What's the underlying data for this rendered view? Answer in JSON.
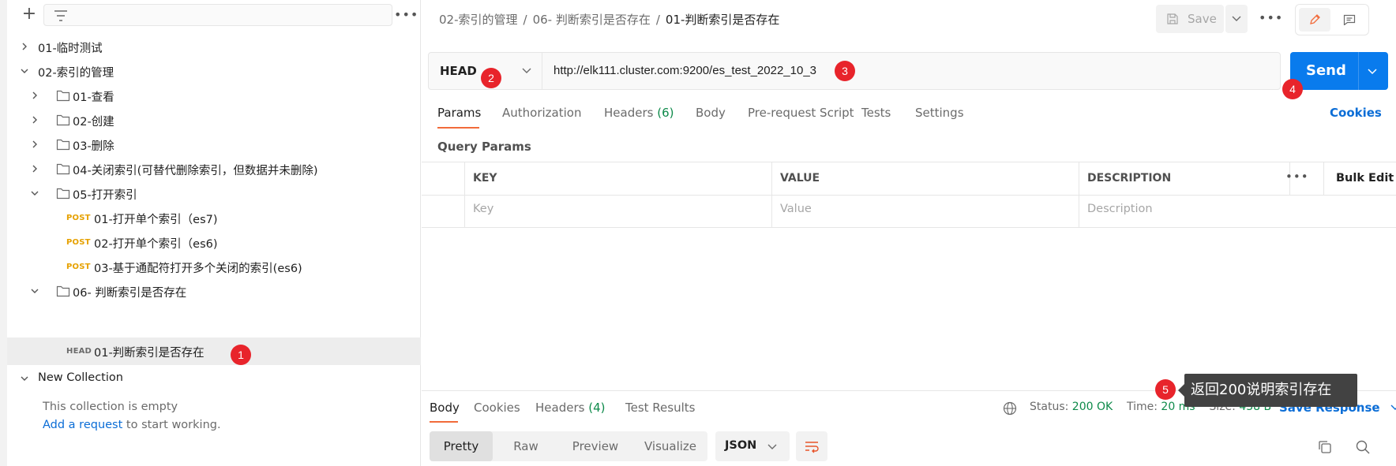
{
  "sidebar": {
    "collections": [
      {
        "label": "01-临时测试"
      },
      {
        "label": "02-索引的管理"
      },
      {
        "label": "01-查看"
      },
      {
        "label": "02-创建"
      },
      {
        "label": "03-删除"
      },
      {
        "label": "04-关闭索引(可替代删除索引，但数据并未删除)"
      },
      {
        "label": "05-打开索引"
      },
      {
        "method": "POST",
        "label": "01-打开单个索引（es7)"
      },
      {
        "method": "POST",
        "label": "02-打开单个索引（es6)"
      },
      {
        "method": "POST",
        "label": "03-基于通配符打开多个关闭的索引(es6)"
      },
      {
        "label": "06- 判断索引是否存在"
      },
      {
        "method": "HEAD",
        "label": "01-判断索引是否存在"
      },
      {
        "label": "New Collection"
      }
    ],
    "empty_text": "This collection is empty",
    "add_request_link": "Add a request",
    "add_request_suffix": " to start working."
  },
  "breadcrumb": {
    "parts": [
      "02-索引的管理",
      "06- 判断索引是否存在"
    ],
    "current": "01-判断索引是否存在"
  },
  "toolbar": {
    "save_label": "Save"
  },
  "request": {
    "method": "HEAD",
    "url": "http://elk111.cluster.com:9200/es_test_2022_10_3",
    "send_label": "Send"
  },
  "request_tabs": [
    {
      "label": "Params"
    },
    {
      "label": "Authorization"
    },
    {
      "label": "Headers",
      "count": "(6)"
    },
    {
      "label": "Body"
    },
    {
      "label": "Pre-request Script"
    },
    {
      "label": "Tests"
    },
    {
      "label": "Settings"
    }
  ],
  "cookies_label": "Cookies",
  "query_params": {
    "title": "Query Params",
    "columns": [
      "KEY",
      "VALUE",
      "DESCRIPTION"
    ],
    "placeholders": [
      "Key",
      "Value",
      "Description"
    ],
    "bulk_edit": "Bulk Edit"
  },
  "response": {
    "tabs": [
      {
        "label": "Body"
      },
      {
        "label": "Cookies"
      },
      {
        "label": "Headers",
        "count": "(4)"
      },
      {
        "label": "Test Results"
      }
    ],
    "status_label": "Status:",
    "status_value": "200 OK",
    "time_label": "Time:",
    "time_value": "20 ms",
    "size_label": "Size:",
    "size_value": "438 B",
    "save_response": "Save Response",
    "formats": [
      "Pretty",
      "Raw",
      "Preview",
      "Visualize"
    ],
    "language": "JSON"
  },
  "annotations": {
    "badges": [
      "1",
      "2",
      "3",
      "4",
      "5"
    ],
    "tooltip": "返回200说明索引存在"
  },
  "colors": {
    "accent_orange": "#f26b3a",
    "send_blue": "#097bed",
    "link_blue": "#0b6dd6",
    "status_green": "#0e8a4a",
    "post_method": "#e6a100",
    "badge_red": "#e8242b"
  }
}
